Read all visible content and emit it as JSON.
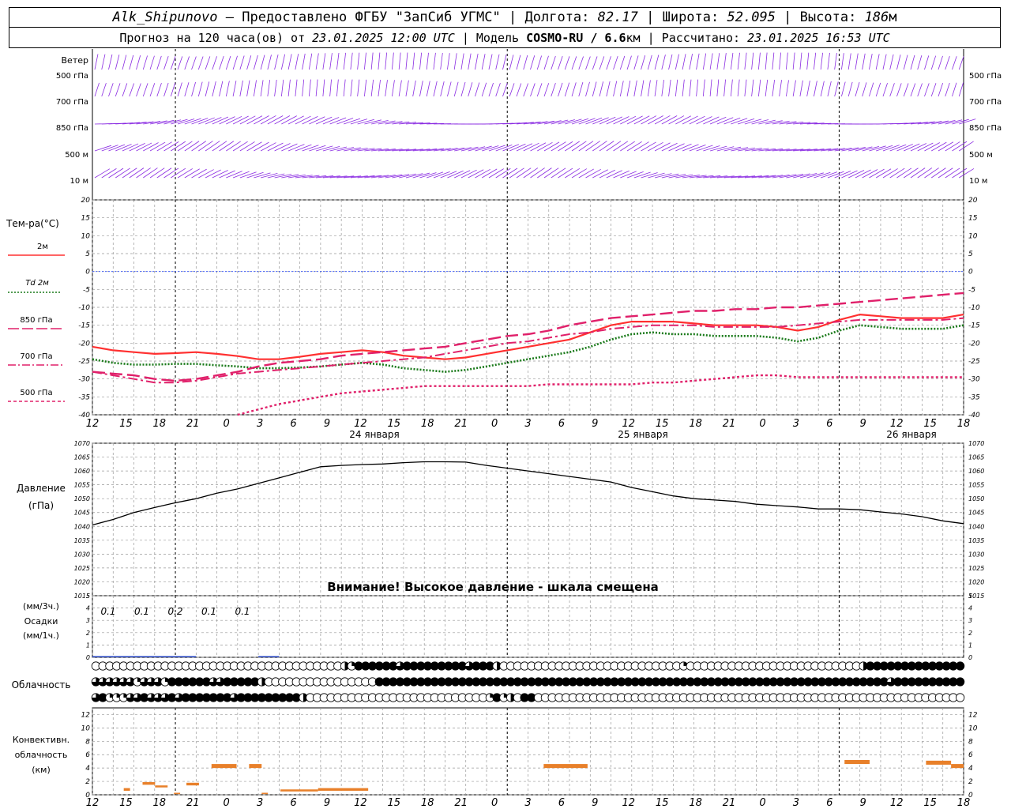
{
  "header": {
    "station": "Alk_Shipunovo",
    "provider": "– Предоставлено ФГБУ \"ЗапСиб УГМС\"",
    "lon_label": "Долгота:",
    "lon": "82.17",
    "lat_label": "Широта:",
    "lat": "52.095",
    "alt_label": "Высота:",
    "alt": "186",
    "alt_unit": "м",
    "forecast_label": "Прогноз на 120 часа(ов) от",
    "forecast_from": "23.01.2025 12:00 UTC",
    "model_label": "Модель",
    "model": "COSMO-RU / 6.6",
    "model_unit": "км",
    "calc_label": "Рассчитано:",
    "calc_time": "23.01.2025 16:53 UTC"
  },
  "time_axis": {
    "hour_labels": [
      "12",
      "15",
      "18",
      "21",
      "0",
      "3",
      "6",
      "9",
      "12",
      "15",
      "18",
      "21",
      "0",
      "3",
      "6",
      "9",
      "12",
      "15",
      "18",
      "21",
      "0",
      "3",
      "6",
      "9",
      "12",
      "15",
      "18"
    ],
    "day_labels": [
      "24 января",
      "25 января",
      "26 января"
    ]
  },
  "panels": {
    "wind": {
      "title": "Ветер",
      "levels": [
        "500 гПа",
        "700 гПа",
        "850 гПа",
        "500  м",
        "10   м"
      ],
      "barb_color": "#8a2be2"
    },
    "temperature": {
      "title": "Тем-ра(°C)",
      "legend": [
        {
          "label": "2м",
          "color": "#ff3030",
          "dash": "solid"
        },
        {
          "label": "Td  2м",
          "color": "#1a7a1a",
          "dash": "dot"
        },
        {
          "label": "850 гПа",
          "color": "#e0206a",
          "dash": "long"
        },
        {
          "label": "700 гПа",
          "color": "#e0206a",
          "dash": "dashdot"
        },
        {
          "label": "500 гПа",
          "color": "#e0206a",
          "dash": "short"
        }
      ],
      "ticks": [
        "20",
        "15",
        "10",
        "5",
        "0",
        "-5",
        "-10",
        "-15",
        "-20",
        "-25",
        "-30",
        "-35",
        "-40"
      ]
    },
    "pressure": {
      "title": "Давление",
      "unit": "(гПа)",
      "ticks": [
        "1070",
        "1065",
        "1060",
        "1055",
        "1050",
        "1045",
        "1040",
        "1035",
        "1030",
        "1025",
        "1020",
        "1015"
      ],
      "warning": "Внимание! Высокое давление - шкала смещена"
    },
    "precip": {
      "unit3": "(мм/3ч.)",
      "title": "Осадки",
      "unit1": "(мм/1ч.)",
      "ticks": [
        "5",
        "4",
        "3",
        "2",
        "1",
        "0"
      ],
      "labels": [
        "0.1",
        "0.1",
        "0.2",
        "0.1",
        "0.1"
      ]
    },
    "cloud": {
      "title": "Облачность"
    },
    "convective": {
      "title1": "Конвективн.",
      "title2": "облачность",
      "unit": "(км)",
      "ticks": [
        "12",
        "10",
        "8",
        "6",
        "4",
        "2",
        "0"
      ]
    }
  },
  "chart_data": [
    {
      "type": "line",
      "title": "Тем-ра(°C)",
      "x_hours": [
        0,
        3,
        6,
        9,
        12,
        15,
        18,
        21,
        24,
        27,
        30,
        33,
        36,
        39,
        42,
        45,
        48,
        51,
        54,
        57,
        60,
        63,
        66,
        69,
        72,
        75,
        78,
        81,
        84,
        87,
        90,
        93,
        96,
        99,
        102,
        105,
        108,
        111,
        114,
        117,
        120,
        123,
        126
      ],
      "ylim": [
        -40,
        20
      ],
      "series": [
        {
          "name": "2м",
          "values": [
            -21,
            -22,
            -22.5,
            -23,
            -22.8,
            -22.5,
            -23,
            -23.6,
            -24.5,
            -24.5,
            -23.8,
            -23,
            -22.5,
            -22,
            -22.5,
            -23.5,
            -24,
            -24.5,
            -24,
            -23,
            -22,
            -21,
            -20,
            -19,
            -17,
            -15,
            -14,
            -14,
            -14,
            -14.5,
            -15,
            -15,
            -15,
            -15.5,
            -16.5,
            -15.5,
            -13.5,
            -12,
            -12.5,
            -13,
            -13,
            -13,
            -12
          ]
        },
        {
          "name": "Td  2м",
          "values": [
            -24.5,
            -25.5,
            -26,
            -26,
            -25.8,
            -25.8,
            -26.2,
            -26.5,
            -27,
            -27,
            -26.8,
            -26.5,
            -26,
            -25.5,
            -26,
            -27,
            -27.5,
            -28,
            -27.5,
            -26.5,
            -25.5,
            -24.5,
            -23.5,
            -22.5,
            -21,
            -19,
            -17.5,
            -17,
            -17.5,
            -17.5,
            -18,
            -18,
            -18,
            -18.5,
            -19.5,
            -18.5,
            -16.5,
            -15,
            -15.5,
            -16,
            -16,
            -16,
            -15
          ]
        },
        {
          "name": "850 гПа",
          "values": [
            -28,
            -28.5,
            -29,
            -30,
            -30.5,
            -30,
            -29,
            -28,
            -26.5,
            -25.5,
            -25,
            -24.5,
            -23.5,
            -23,
            -22.5,
            -22,
            -21.5,
            -21,
            -20,
            -19,
            -18,
            -17.5,
            -16.5,
            -15,
            -14,
            -13,
            -12.5,
            -12,
            -11.5,
            -11,
            -11,
            -10.5,
            -10.5,
            -10,
            -10,
            -9.5,
            -9,
            -8.5,
            -8,
            -7.5,
            -7,
            -6.5,
            -6
          ]
        },
        {
          "name": "700 гПа",
          "values": [
            -28,
            -29,
            -30,
            -31,
            -31,
            -30.5,
            -29.5,
            -28.5,
            -28,
            -27.5,
            -27,
            -26.5,
            -26,
            -25.5,
            -25,
            -24.5,
            -24,
            -23,
            -22,
            -21,
            -20,
            -19.5,
            -18.5,
            -17.5,
            -17,
            -16,
            -15.5,
            -15,
            -15,
            -15,
            -15.5,
            -15.5,
            -15.5,
            -15.5,
            -15,
            -14.5,
            -14,
            -13.5,
            -13.5,
            -13.5,
            -13.5,
            -13.5,
            -13
          ]
        },
        {
          "name": "500 гПа",
          "values": [
            null,
            null,
            null,
            null,
            null,
            null,
            null,
            -40,
            -38.5,
            -37,
            -36,
            -35,
            -34,
            -33.5,
            -33,
            -32.5,
            -32,
            -32,
            -32,
            -32,
            -32,
            -32,
            -31.5,
            -31.5,
            -31.5,
            -31.5,
            -31.5,
            -31,
            -31,
            -30.5,
            -30,
            -29.5,
            -29,
            -29,
            -29.5,
            -29.5,
            -29.5,
            -29.5,
            -29.5,
            -29.5,
            -29.5,
            -29.5,
            -29.5
          ]
        }
      ]
    },
    {
      "type": "line",
      "title": "Давление",
      "x_hours": [
        0,
        3,
        6,
        9,
        12,
        15,
        18,
        21,
        24,
        27,
        30,
        33,
        36,
        39,
        42,
        45,
        48,
        51,
        54,
        57,
        60,
        63,
        66,
        69,
        72,
        75,
        78,
        81,
        84,
        87,
        90,
        93,
        96,
        99,
        102,
        105,
        108,
        111,
        114,
        117,
        120,
        123,
        126
      ],
      "ylim": [
        1015,
        1070
      ],
      "series": [
        {
          "name": "Давление",
          "values": [
            1040.5,
            1042.5,
            1045,
            1046.8,
            1048.5,
            1050,
            1052,
            1053.5,
            1055.5,
            1057.5,
            1059.5,
            1061.5,
            1062,
            1062.3,
            1062.5,
            1063,
            1063.3,
            1063.3,
            1063.2,
            1062,
            1061,
            1060,
            1059,
            1058,
            1057,
            1056,
            1054,
            1052.5,
            1051,
            1050,
            1049.5,
            1049,
            1048,
            1047.5,
            1047,
            1046.3,
            1046.3,
            1046,
            1045.2,
            1044.5,
            1043.5,
            1042,
            1041
          ]
        }
      ]
    },
    {
      "type": "bar",
      "title": "Осадки",
      "x_hours": [
        12,
        15,
        18,
        21,
        24,
        27,
        30,
        33,
        36,
        39,
        42,
        45
      ],
      "ylim": [
        0,
        5
      ],
      "values": [
        0.1,
        0.1,
        0.2,
        0.1,
        0.1,
        0.0,
        0.0,
        0.0,
        0.05,
        0.0,
        0.0,
        0.0
      ]
    },
    {
      "type": "bar",
      "title": "Конвективн. облачность",
      "ylim": [
        0,
        13
      ],
      "segments": [
        {
          "x0": 5,
          "x1": 6,
          "bottom": 0.6,
          "top": 1.0
        },
        {
          "x0": 8,
          "x1": 10,
          "bottom": 1.5,
          "top": 1.9
        },
        {
          "x0": 10,
          "x1": 12,
          "bottom": 1.1,
          "top": 1.4
        },
        {
          "x0": 13,
          "x1": 14,
          "bottom": 0.1,
          "top": 0.3
        },
        {
          "x0": 15,
          "x1": 17,
          "bottom": 1.4,
          "top": 1.8
        },
        {
          "x0": 19,
          "x1": 23,
          "bottom": 4.0,
          "top": 4.6
        },
        {
          "x0": 25,
          "x1": 27,
          "bottom": 4.0,
          "top": 4.6
        },
        {
          "x0": 27,
          "x1": 28,
          "bottom": 0.1,
          "top": 0.3
        },
        {
          "x0": 30,
          "x1": 36,
          "bottom": 0.5,
          "top": 0.8
        },
        {
          "x0": 36,
          "x1": 44,
          "bottom": 0.6,
          "top": 1.0
        },
        {
          "x0": 72,
          "x1": 79,
          "bottom": 4.0,
          "top": 4.6
        },
        {
          "x0": 120,
          "x1": 124,
          "bottom": 4.6,
          "top": 5.2
        },
        {
          "x0": 133,
          "x1": 137,
          "bottom": 4.5,
          "top": 5.1
        },
        {
          "x0": 137,
          "x1": 139,
          "bottom": 4.0,
          "top": 4.6
        }
      ]
    }
  ],
  "cloud_rows": {
    "row1": "0000000000000000000000000000000000002144444434444444443444200000000000000000000000000100000000000000000000000002444444444444444444",
    "row2": "3333331333144444433444442000000000000000044444444444444444444444444444444444444444444444444444444444444444444444444344444444444444444",
    "row3": "3411133433343444444434444444442000000000000000000000000001412044000000000000000000000000000000000000000000000000000000000000000000"
  }
}
